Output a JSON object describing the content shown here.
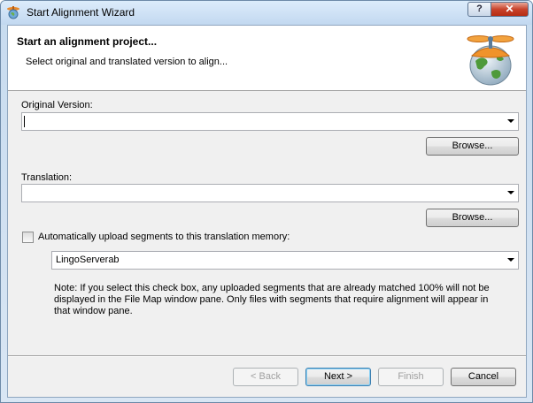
{
  "window": {
    "title": "Start Alignment Wizard",
    "help_label": "?",
    "close_label": "✕"
  },
  "header": {
    "title": "Start an alignment project...",
    "subtitle": "Select original and translated version to align..."
  },
  "original": {
    "label": "Original Version:",
    "value": "",
    "browse_label": "Browse..."
  },
  "translation": {
    "label": "Translation:",
    "value": "",
    "browse_label": "Browse..."
  },
  "upload": {
    "checkbox_label": "Automatically upload segments to this translation memory:",
    "checked": false,
    "tm_selected": "LingoServerab"
  },
  "note": "Note: If you select this check box, any uploaded segments that are already matched 100% will not be displayed in the File Map window pane. Only files with segments that require alignment will appear in that window pane.",
  "footer": {
    "back_label": "< Back",
    "next_label": "Next >",
    "finish_label": "Finish",
    "cancel_label": "Cancel"
  }
}
